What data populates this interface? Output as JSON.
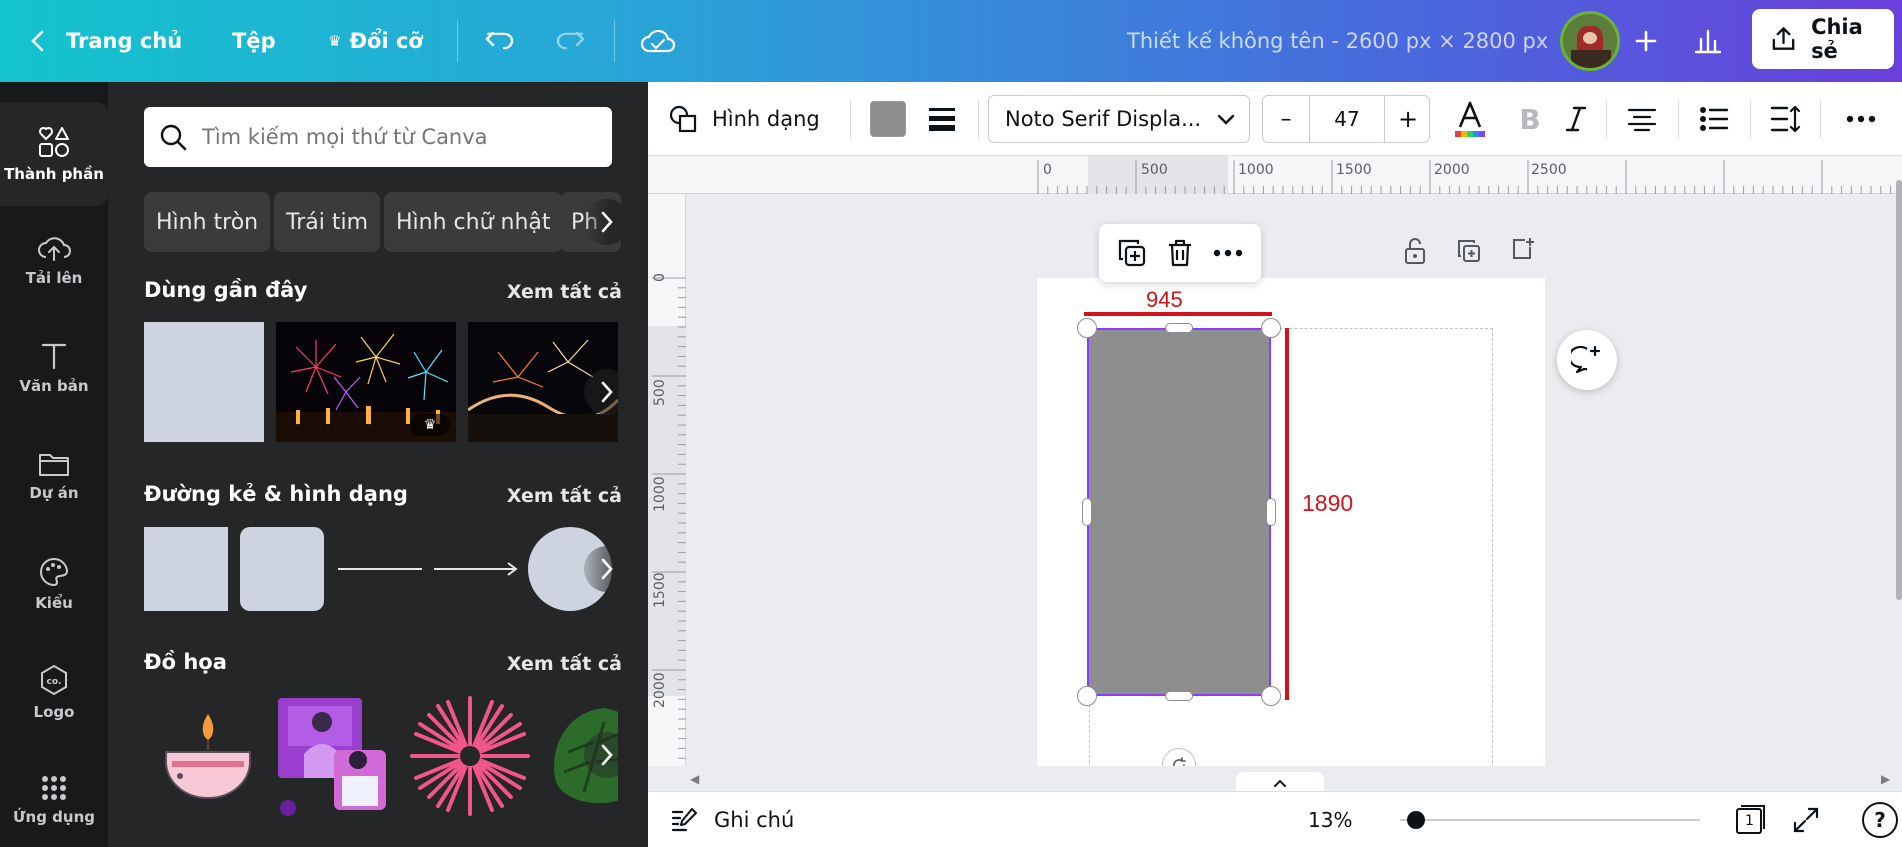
{
  "topbar": {
    "home_label": "Trang chủ",
    "file_label": "Tệp",
    "resize_label": "Đổi cỡ",
    "doc_title": "Thiết kế không tên - 2600 px × 2800 px",
    "share_label": "Chia sẻ"
  },
  "rail": {
    "items": [
      {
        "label": "Thành phần",
        "icon": "elements-icon"
      },
      {
        "label": "Tải lên",
        "icon": "upload-cloud-icon"
      },
      {
        "label": "Văn bản",
        "icon": "text-icon"
      },
      {
        "label": "Dự án",
        "icon": "folder-icon"
      },
      {
        "label": "Kiểu",
        "icon": "palette-icon"
      },
      {
        "label": "Logo",
        "icon": "logo-icon"
      },
      {
        "label": "Ứng dụng",
        "icon": "apps-grid-icon"
      }
    ]
  },
  "panel": {
    "search_placeholder": "Tìm kiếm mọi thứ từ Canva",
    "chips": [
      "Hình tròn",
      "Trái tim",
      "Hình chữ nhật",
      "Ph"
    ],
    "recent_title": "Dùng gần đây",
    "lines_title": "Đường kẻ & hình dạng",
    "graphics_title": "Đồ họa",
    "see_all": "Xem tất cả"
  },
  "toolbar": {
    "shape_label": "Hình dạng",
    "fill_color": "#8e8e8e",
    "font_name": "Noto Serif Displa...",
    "font_size": "47",
    "minus": "–",
    "plus": "+"
  },
  "ruler": {
    "h_ticks": [
      "0",
      "500",
      "1000",
      "1500",
      "2000",
      "2500"
    ],
    "v_ticks": [
      "0",
      "500",
      "1000",
      "1500",
      "2000"
    ]
  },
  "canvas": {
    "width_label": "945",
    "height_label": "1890",
    "measure_color": "#d0141c",
    "shape_color": "#8e8e8e",
    "selection_color": "#8b3dff"
  },
  "bottombar": {
    "notes_label": "Ghi chú",
    "zoom": "13%",
    "page_count": "1",
    "help": "?"
  },
  "colors": {
    "accent": "#8b3dff",
    "panel_bg": "#252627",
    "rail_bg": "#18191b"
  }
}
